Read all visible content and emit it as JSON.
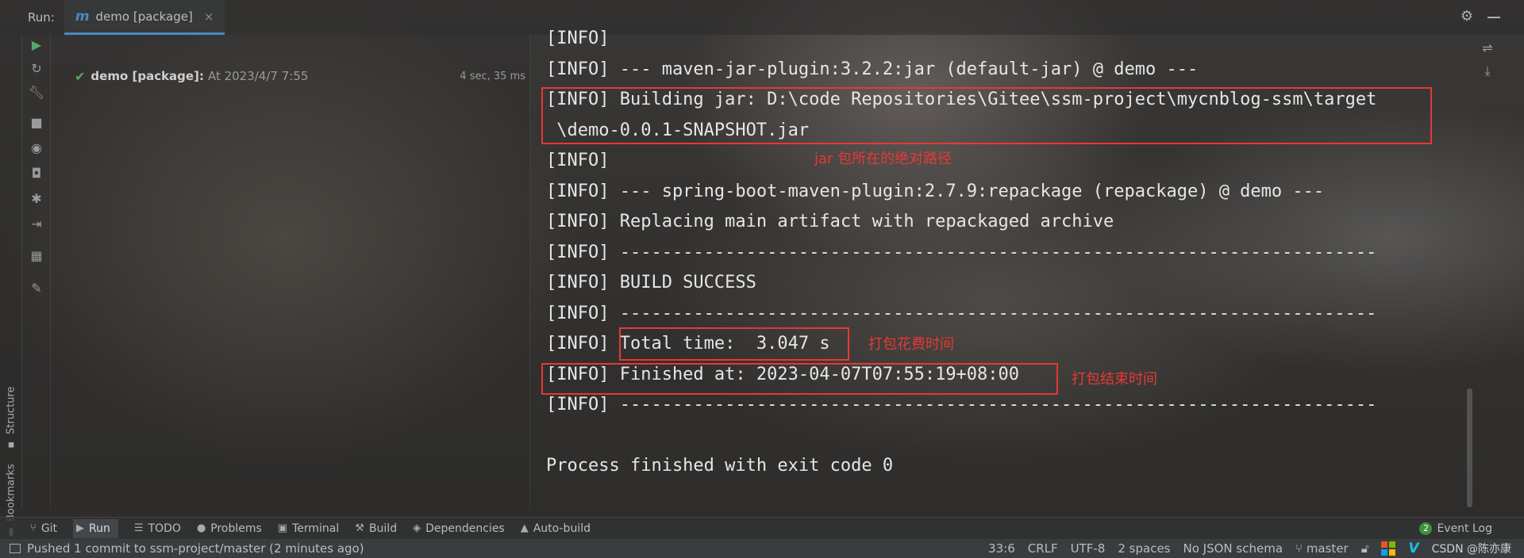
{
  "tabbar": {
    "run_label": "Run:",
    "tab_icon_text": "m",
    "tab_label": "demo [package]",
    "close_glyph": "×"
  },
  "tree": {
    "name": "demo [package]:",
    "time": "At 2023/4/7 7:55",
    "duration": "4 sec, 35 ms"
  },
  "console": {
    "lines": [
      "[INFO]",
      "[INFO] --- maven-jar-plugin:3.2.2:jar (default-jar) @ demo ---",
      "[INFO] Building jar: D:\\code Repositories\\Gitee\\ssm-project\\mycnblog-ssm\\target",
      " \\demo-0.0.1-SNAPSHOT.jar",
      "[INFO]",
      "[INFO] --- spring-boot-maven-plugin:2.7.9:repackage (repackage) @ demo ---",
      "[INFO] Replacing main artifact with repackaged archive",
      "[INFO] ------------------------------------------------------------------------",
      "[INFO] BUILD SUCCESS",
      "[INFO] ------------------------------------------------------------------------",
      "[INFO] Total time:  3.047 s",
      "[INFO] Finished at: 2023-04-07T07:55:19+08:00",
      "[INFO] ------------------------------------------------------------------------",
      "",
      "Process finished with exit code 0"
    ],
    "notes": {
      "jar_path": "jar 包所在的绝对路径",
      "total_time": "打包花费时间",
      "finished_at": "打包结束时间"
    },
    "highlight_color": "#e53935"
  },
  "left_vertical_tabs": {
    "structure": "Structure",
    "bookmarks": "Bookmarks"
  },
  "bottom_tabs": [
    {
      "label": "Git",
      "icon": "git-branch-icon"
    },
    {
      "label": "Run",
      "icon": "play-icon"
    },
    {
      "label": "TODO",
      "icon": "list-icon"
    },
    {
      "label": "Problems",
      "icon": "info-icon"
    },
    {
      "label": "Terminal",
      "icon": "terminal-icon"
    },
    {
      "label": "Build",
      "icon": "hammer-icon"
    },
    {
      "label": "Dependencies",
      "icon": "layers-icon"
    },
    {
      "label": "Auto-build",
      "icon": "warning-icon"
    }
  ],
  "event_log": {
    "count": "2",
    "label": "Event Log"
  },
  "status_bar": {
    "message": "Pushed 1 commit to ssm-project/master (2 minutes ago)",
    "position": "33:6",
    "line_ending": "CRLF",
    "encoding": "UTF-8",
    "indent": "2 spaces",
    "schema": "No JSON schema",
    "branch": "master",
    "watermark": "CSDN @陈亦康"
  },
  "colors": {
    "accent": "#4a88c7",
    "success": "#59a869",
    "highlight": "#e53935"
  }
}
